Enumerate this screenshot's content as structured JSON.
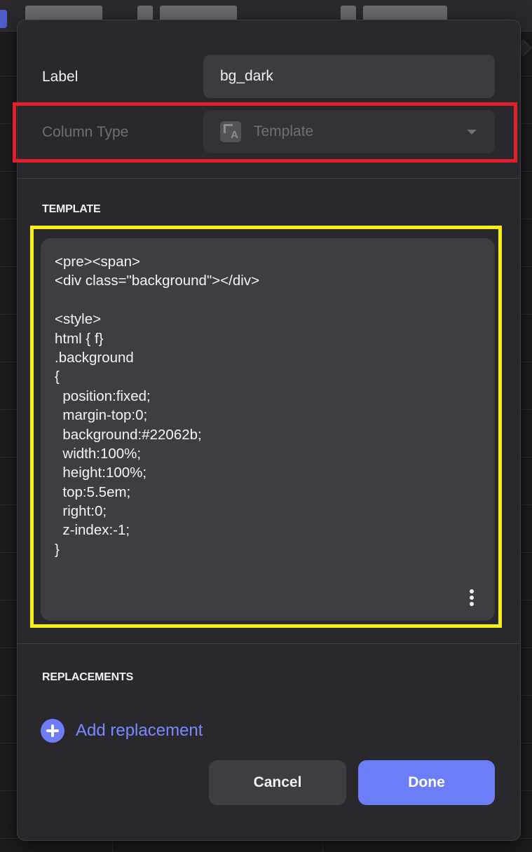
{
  "form": {
    "label_title": "Label",
    "label_value": "bg_dark",
    "column_type_title": "Column Type",
    "column_type_value": "Template",
    "column_type_icon": "template-type-icon"
  },
  "template": {
    "heading": "TEMPLATE",
    "code_lines": [
      "<pre><span>",
      "<div class=\"background\"></div>",
      "",
      "<style>",
      "html { f}",
      ".background",
      "{",
      "  position:fixed;",
      "  margin-top:0;",
      "  background:#22062b;",
      "  width:100%;",
      "  height:100%;",
      "  top:5.5em;",
      "  right:0;",
      "  z-index:-1;",
      "}"
    ]
  },
  "replacements": {
    "heading": "REPLACEMENTS",
    "add_label": "Add replacement"
  },
  "actions": {
    "cancel_label": "Cancel",
    "done_label": "Done"
  },
  "colors": {
    "accent": "#6c7ef7",
    "link": "#7c88ff",
    "highlight_red": "#e0202a",
    "highlight_yellow": "#f7ee16"
  }
}
